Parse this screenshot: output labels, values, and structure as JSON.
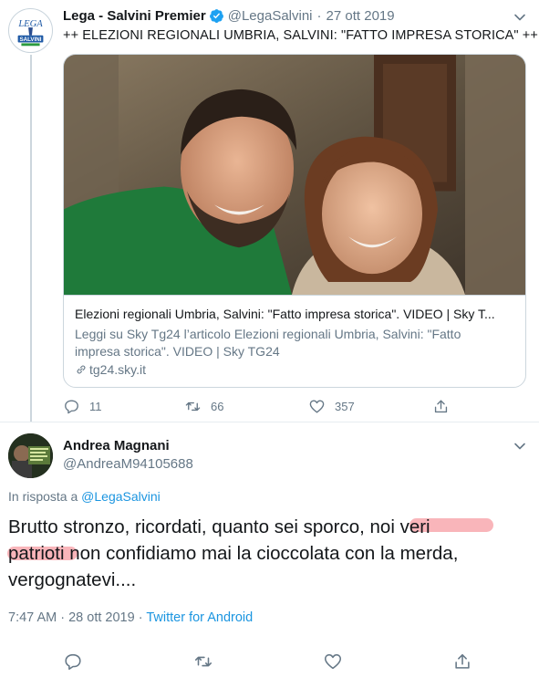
{
  "tweet1": {
    "avatar_text": "LEGA",
    "avatar_subtext": "SALVINI",
    "name": "Lega - Salvini Premier",
    "handle": "@LegaSalvini",
    "separator": "·",
    "date": "27 ott 2019",
    "text": "++ ELEZIONI REGIONALI UMBRIA, SALVINI: \"FATTO IMPRESA STORICA\" ++",
    "card": {
      "title": "Elezioni regionali Umbria, Salvini: \"Fatto impresa storica\". VIDEO | Sky T...",
      "description": "Leggi su Sky Tg24 l’articolo Elezioni regionali Umbria, Salvini: \"Fatto impresa storica\". VIDEO | Sky TG24",
      "domain": "tg24.sky.it"
    },
    "actions": {
      "replies": "11",
      "retweets": "66",
      "likes": "357"
    }
  },
  "tweet2": {
    "name": "Andrea Magnani",
    "handle": "@AndreaM94105688",
    "reply_prefix": "In risposta a",
    "reply_mention": "@LegaSalvini",
    "text_part1": "Brutto stronzo, ricordati, quanto sei sporco, ",
    "text_hl1": "noi veri",
    "text_hl2": "patrioti",
    "text_part2": " non confidiamo mai la cioccolata con la merda, vergognatevi....",
    "time": "7:47 AM",
    "separator": "·",
    "date": "28 ott 2019",
    "meta_sep": "·",
    "source": "Twitter for Android"
  },
  "icons": {
    "verified": "verified-badge-icon",
    "chevron": "chevron-down-icon",
    "reply": "reply-icon",
    "retweet": "retweet-icon",
    "like": "heart-icon",
    "share": "share-icon",
    "link": "link-icon"
  },
  "colors": {
    "accent": "#1da1f2",
    "link": "#1b95e0",
    "secondary_text": "#657786",
    "border": "#ccd6dd",
    "highlight": "#f47882"
  }
}
